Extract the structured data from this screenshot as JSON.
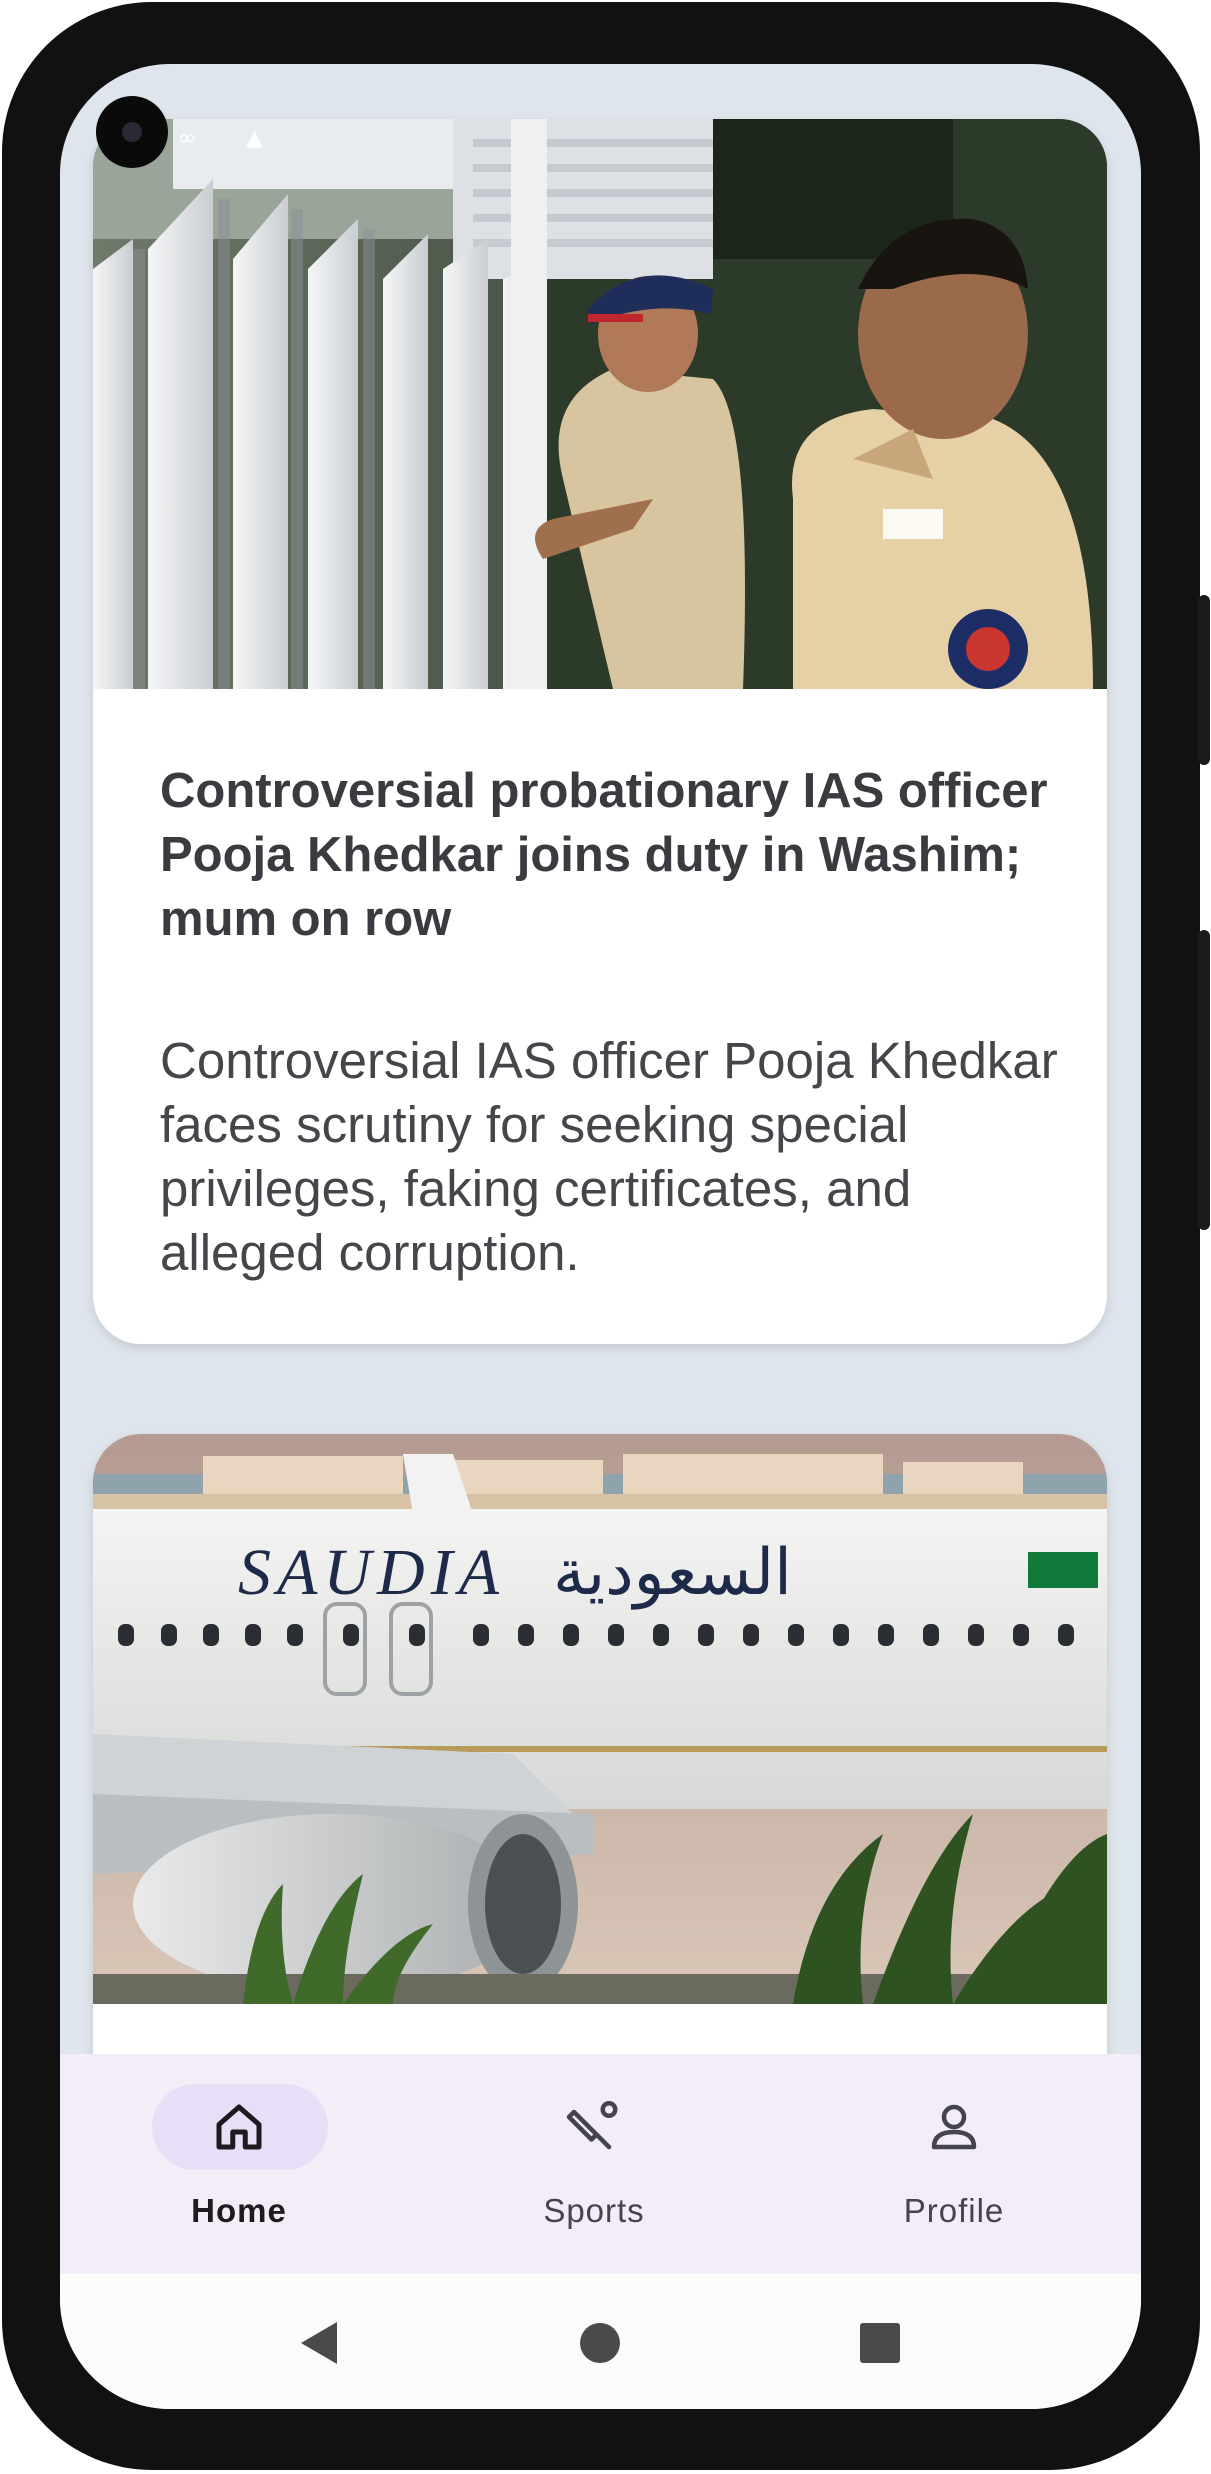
{
  "articles": [
    {
      "image_icon": "news-photo-police-officers",
      "title": "Controversial probationary IAS officer Pooja Khedkar joins duty in Washim; mum on row",
      "description": "Controversial IAS officer Pooja Khedkar faces scrutiny for seeking special privileges, faking certificates, and alleged corruption."
    },
    {
      "image_icon": "news-photo-saudia-airplane",
      "image_text": {
        "latin": "SAUDIA",
        "arabic": "السعودية"
      },
      "title": "",
      "description": ""
    }
  ],
  "bottom_nav": {
    "items": [
      {
        "label": "Home",
        "icon": "home-icon",
        "selected": true
      },
      {
        "label": "Sports",
        "icon": "sports-icon",
        "selected": false
      },
      {
        "label": "Profile",
        "icon": "person-icon",
        "selected": false
      }
    ]
  },
  "colors": {
    "background": "#dfe5ec",
    "nav_background": "#f3edf7",
    "nav_selected_pill": "#e8def8",
    "title_text": "#3b3a40"
  }
}
